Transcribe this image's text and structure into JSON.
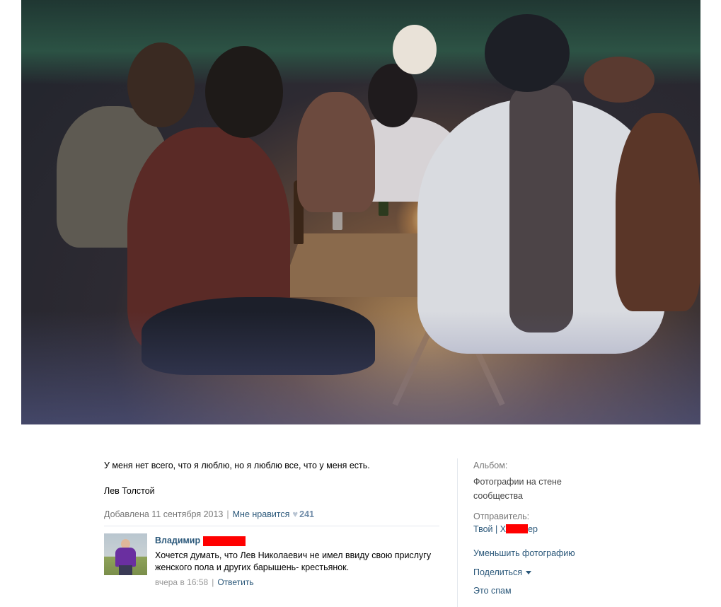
{
  "photo": {
    "icon": "photo-image"
  },
  "post": {
    "caption": "У меня нет всего, что я люблю, но я люблю все, что у меня есть.",
    "author": "Лев Толстой",
    "added": "Добавлена 11 сентября 2013",
    "like_label": "Мне нравится",
    "like_icon": "heart-icon",
    "like_count": "241"
  },
  "comment": {
    "name": "Владимир",
    "text": "Хочется думать, что Лев Николаевич не имел ввиду свою прислугу женского пола и других барышень- крестьянок.",
    "time": "вчера в 16:58",
    "reply_label": "Ответить",
    "redaction_color": "#ff0000"
  },
  "sidebar": {
    "album_label": "Альбом:",
    "album_name": "Фотографии на стене сообщества",
    "sender_label": "Отправитель:",
    "sender_part1": "Твой | Х",
    "sender_part2": "ер",
    "shrink_label": "Уменьшить фотографию",
    "share_label": "Поделиться",
    "spam_label": "Это спам"
  },
  "colors": {
    "link": "#2b587a",
    "muted": "#777777"
  }
}
